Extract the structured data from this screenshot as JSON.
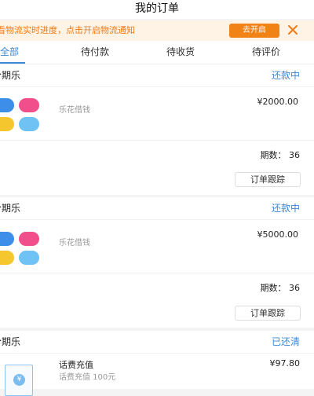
{
  "header": {
    "title": "我的订单"
  },
  "notice": {
    "text": "看物流实时进度，点击开启物流通知",
    "button": "去开启",
    "close_icon": "close-x-icon"
  },
  "tabs": [
    {
      "label": "全部",
      "active": true
    },
    {
      "label": "待付款",
      "active": false
    },
    {
      "label": "待收货",
      "active": false
    },
    {
      "label": "待评价",
      "active": false
    }
  ],
  "orders": [
    {
      "name": "分期乐",
      "status": "还款中",
      "product": "乐花借钱",
      "price": "¥2000.00",
      "periods_label": "期数：",
      "periods": "36",
      "track_button": "订单跟踪",
      "icon": "lehua-logo-icon"
    },
    {
      "name": "分期乐",
      "status": "还款中",
      "product": "乐花借钱",
      "price": "¥5000.00",
      "periods_label": "期数：",
      "periods": "36",
      "track_button": "订单跟踪",
      "icon": "lehua-logo-icon"
    },
    {
      "name": "分期乐",
      "status": "已还清",
      "product": "话费充值",
      "desc": "话费充值 100元",
      "price": "¥97.80",
      "icon": "phone-recharge-icon",
      "coin_symbol": "¥"
    }
  ],
  "colors": {
    "accent": "#3b87d6",
    "notice_bg": "#fff3e6",
    "notice_text": "#f07a14",
    "notice_button": "#f08216"
  }
}
